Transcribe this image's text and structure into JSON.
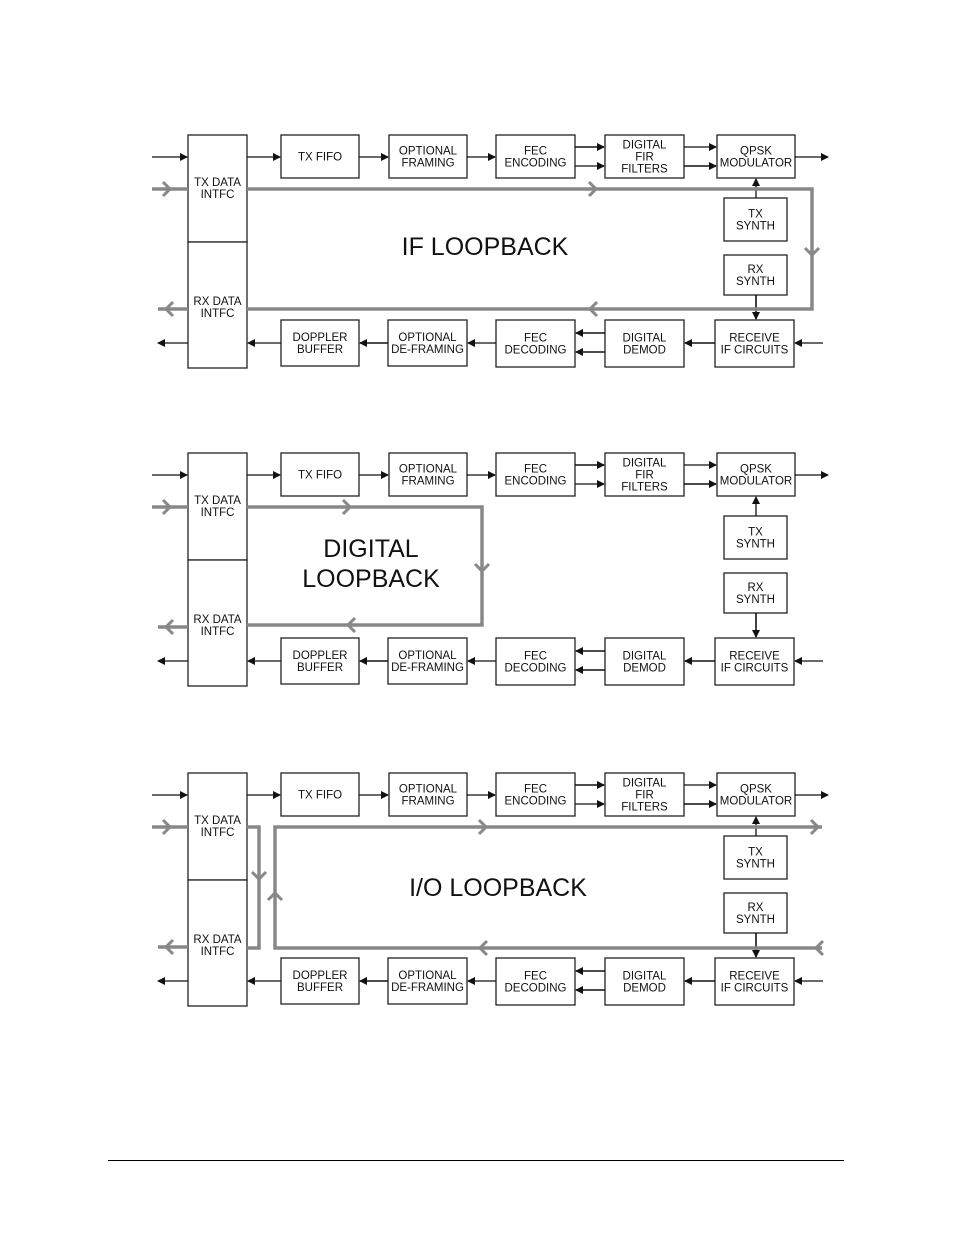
{
  "diagrams": [
    {
      "title": "IF LOOPBACK",
      "blocks": {
        "tx_data": [
          "TX DATA",
          "INTFC"
        ],
        "rx_data": [
          "RX DATA",
          "INTFC"
        ],
        "tx_fifo": [
          "TX FIFO"
        ],
        "opt_framing": [
          "OPTIONAL",
          "FRAMING"
        ],
        "fec_enc": [
          "FEC",
          "ENCODING"
        ],
        "fir": [
          "DIGITAL",
          "FIR",
          "FILTERS"
        ],
        "qpsk": [
          "QPSK",
          "MODULATOR"
        ],
        "tx_synth": [
          "TX",
          "SYNTH"
        ],
        "rx_synth": [
          "RX",
          "SYNTH"
        ],
        "doppler": [
          "DOPPLER",
          "BUFFER"
        ],
        "opt_deframing": [
          "OPTIONAL",
          "DE-FRAMING"
        ],
        "fec_dec": [
          "FEC",
          "DECODING"
        ],
        "demod": [
          "DIGITAL",
          "DEMOD"
        ],
        "receive_if": [
          "RECEIVE",
          "IF CIRCUITS"
        ]
      },
      "loop_type": "if"
    },
    {
      "title": "DIGITAL LOOPBACK",
      "title_lines": [
        "DIGITAL",
        "LOOPBACK"
      ],
      "loop_type": "digital"
    },
    {
      "title": "I/O LOOPBACK",
      "loop_type": "io"
    }
  ],
  "labels": {
    "tx_data": [
      "TX DATA",
      "INTFC"
    ],
    "rx_data": [
      "RX DATA",
      "INTFC"
    ],
    "tx_fifo": [
      "TX FIFO"
    ],
    "opt_framing": [
      "OPTIONAL",
      "FRAMING"
    ],
    "fec_enc": [
      "FEC",
      "ENCODING"
    ],
    "fir": [
      "DIGITAL",
      "FIR",
      "FILTERS"
    ],
    "qpsk": [
      "QPSK",
      "MODULATOR"
    ],
    "tx_synth": [
      "TX",
      "SYNTH"
    ],
    "rx_synth": [
      "RX",
      "SYNTH"
    ],
    "doppler": [
      "DOPPLER",
      "BUFFER"
    ],
    "opt_deframing": [
      "OPTIONAL",
      "DE-FRAMING"
    ],
    "fec_dec": [
      "FEC",
      "DECODING"
    ],
    "demod": [
      "DIGITAL",
      "DEMOD"
    ],
    "receive_if": [
      "RECEIVE",
      "IF CIRCUITS"
    ]
  },
  "colors": {
    "loop": "#888888",
    "line": "#111111"
  }
}
